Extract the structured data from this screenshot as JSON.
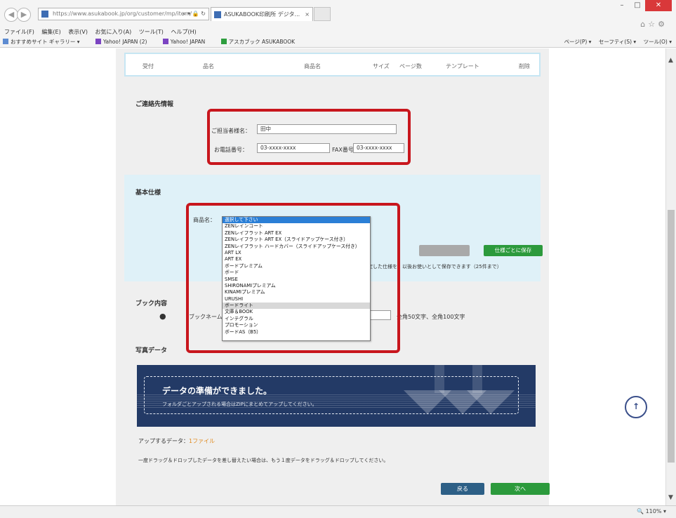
{
  "browser": {
    "address": "https://www.asukabook.jp/org/customer/mp/item/",
    "tab_title": "ASUKABOOK印刷所 デジタ...",
    "tab_close": "×",
    "menu": [
      "ファイル(F)",
      "編集(E)",
      "表示(V)",
      "お気に入り(A)",
      "ツール(T)",
      "ヘルプ(H)"
    ],
    "favorites": [
      "おすすめサイト ギャラリー ▾",
      "Yahoo! JAPAN (2)",
      "Yahoo! JAPAN",
      "アスカブック ASUKABOOK"
    ],
    "commands": [
      "ページ(P) ▾",
      "セーフティ(S) ▾",
      "ツール(O) ▾"
    ],
    "zoom": "110%"
  },
  "table_header": [
    "受付",
    "品名",
    "商品名",
    "サイズ",
    "ページ数",
    "テンプレート",
    "削除"
  ],
  "contact": {
    "title": "ご連絡先情報",
    "name_label": "ご担当者様名：",
    "name_value": "田中",
    "phone_label": "お電話番号：",
    "phone_value": "03-xxxx-xxxx",
    "fax_label": "FAX番号：",
    "fax_value": "03-xxxx-xxxx"
  },
  "spec": {
    "title": "基本仕様",
    "product_label": "商品名：",
    "dropdown_options": [
      "選択して下さい",
      "ZENレインコート",
      "ZENレイフラット ART EX",
      "ZENレイフラット ART EX（スライドアップケース付き）",
      "ZENレイフラット ハードカバー（スライドアップケース付き）",
      "ART LX",
      "ART EX",
      "ボードプレミアム",
      "ボード",
      "SMSE",
      "SHIRONAMIプレミアム",
      "KINAMIプレミアム",
      "URUSHI",
      "ボードライト",
      "文庫＆BOOK",
      "インテグラル",
      "プロモーション",
      "ボードAS（B5）"
    ],
    "selected_index": 0,
    "highlight_index": 13,
    "btn_green": "仕様ごとに保存",
    "note": "設定した仕様を、以後お使いとして保存できます（25件まで）"
  },
  "book": {
    "title": "ブック内容",
    "name_label": "ブックネーム：",
    "hint": "全角50文字、全角100文字"
  },
  "manuscript": {
    "title": "写真データ",
    "upload_main": "データの準備ができました。",
    "upload_sub": "フォルダごとアップされる場合はZIPにまとめてアップしてください。",
    "uploaded_prefix": "アップするデータ：",
    "uploaded_count": "1ファイル",
    "note": "一度ドラッグ＆ドロップしたデータを差し替えたい場合は、もう１度データをドラッグ＆ドロップしてください。"
  },
  "buttons": {
    "back": "戻る",
    "next": "次へ"
  },
  "colors": {
    "accent_red": "#c8161d",
    "green": "#2c9a3c",
    "navy": "#233a66",
    "light_blue": "#dff1f8"
  }
}
